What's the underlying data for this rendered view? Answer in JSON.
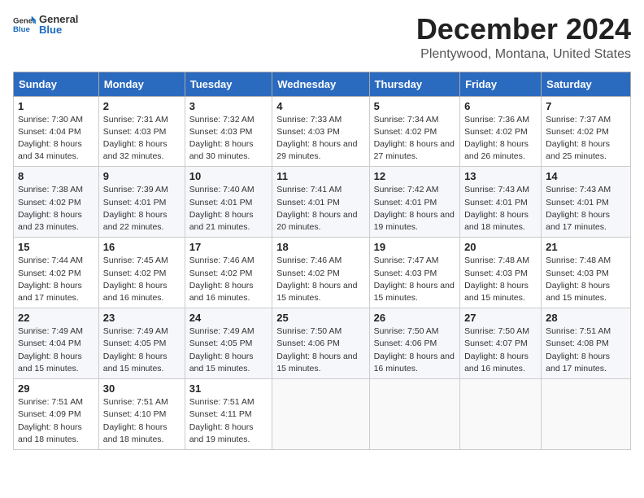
{
  "header": {
    "logo_general": "General",
    "logo_blue": "Blue",
    "month_title": "December 2024",
    "location": "Plentywood, Montana, United States"
  },
  "days_of_week": [
    "Sunday",
    "Monday",
    "Tuesday",
    "Wednesday",
    "Thursday",
    "Friday",
    "Saturday"
  ],
  "weeks": [
    [
      {
        "day": "1",
        "sunrise": "7:30 AM",
        "sunset": "4:04 PM",
        "daylight": "8 hours and 34 minutes."
      },
      {
        "day": "2",
        "sunrise": "7:31 AM",
        "sunset": "4:03 PM",
        "daylight": "8 hours and 32 minutes."
      },
      {
        "day": "3",
        "sunrise": "7:32 AM",
        "sunset": "4:03 PM",
        "daylight": "8 hours and 30 minutes."
      },
      {
        "day": "4",
        "sunrise": "7:33 AM",
        "sunset": "4:03 PM",
        "daylight": "8 hours and 29 minutes."
      },
      {
        "day": "5",
        "sunrise": "7:34 AM",
        "sunset": "4:02 PM",
        "daylight": "8 hours and 27 minutes."
      },
      {
        "day": "6",
        "sunrise": "7:36 AM",
        "sunset": "4:02 PM",
        "daylight": "8 hours and 26 minutes."
      },
      {
        "day": "7",
        "sunrise": "7:37 AM",
        "sunset": "4:02 PM",
        "daylight": "8 hours and 25 minutes."
      }
    ],
    [
      {
        "day": "8",
        "sunrise": "7:38 AM",
        "sunset": "4:02 PM",
        "daylight": "8 hours and 23 minutes."
      },
      {
        "day": "9",
        "sunrise": "7:39 AM",
        "sunset": "4:01 PM",
        "daylight": "8 hours and 22 minutes."
      },
      {
        "day": "10",
        "sunrise": "7:40 AM",
        "sunset": "4:01 PM",
        "daylight": "8 hours and 21 minutes."
      },
      {
        "day": "11",
        "sunrise": "7:41 AM",
        "sunset": "4:01 PM",
        "daylight": "8 hours and 20 minutes."
      },
      {
        "day": "12",
        "sunrise": "7:42 AM",
        "sunset": "4:01 PM",
        "daylight": "8 hours and 19 minutes."
      },
      {
        "day": "13",
        "sunrise": "7:43 AM",
        "sunset": "4:01 PM",
        "daylight": "8 hours and 18 minutes."
      },
      {
        "day": "14",
        "sunrise": "7:43 AM",
        "sunset": "4:01 PM",
        "daylight": "8 hours and 17 minutes."
      }
    ],
    [
      {
        "day": "15",
        "sunrise": "7:44 AM",
        "sunset": "4:02 PM",
        "daylight": "8 hours and 17 minutes."
      },
      {
        "day": "16",
        "sunrise": "7:45 AM",
        "sunset": "4:02 PM",
        "daylight": "8 hours and 16 minutes."
      },
      {
        "day": "17",
        "sunrise": "7:46 AM",
        "sunset": "4:02 PM",
        "daylight": "8 hours and 16 minutes."
      },
      {
        "day": "18",
        "sunrise": "7:46 AM",
        "sunset": "4:02 PM",
        "daylight": "8 hours and 15 minutes."
      },
      {
        "day": "19",
        "sunrise": "7:47 AM",
        "sunset": "4:03 PM",
        "daylight": "8 hours and 15 minutes."
      },
      {
        "day": "20",
        "sunrise": "7:48 AM",
        "sunset": "4:03 PM",
        "daylight": "8 hours and 15 minutes."
      },
      {
        "day": "21",
        "sunrise": "7:48 AM",
        "sunset": "4:03 PM",
        "daylight": "8 hours and 15 minutes."
      }
    ],
    [
      {
        "day": "22",
        "sunrise": "7:49 AM",
        "sunset": "4:04 PM",
        "daylight": "8 hours and 15 minutes."
      },
      {
        "day": "23",
        "sunrise": "7:49 AM",
        "sunset": "4:05 PM",
        "daylight": "8 hours and 15 minutes."
      },
      {
        "day": "24",
        "sunrise": "7:49 AM",
        "sunset": "4:05 PM",
        "daylight": "8 hours and 15 minutes."
      },
      {
        "day": "25",
        "sunrise": "7:50 AM",
        "sunset": "4:06 PM",
        "daylight": "8 hours and 15 minutes."
      },
      {
        "day": "26",
        "sunrise": "7:50 AM",
        "sunset": "4:06 PM",
        "daylight": "8 hours and 16 minutes."
      },
      {
        "day": "27",
        "sunrise": "7:50 AM",
        "sunset": "4:07 PM",
        "daylight": "8 hours and 16 minutes."
      },
      {
        "day": "28",
        "sunrise": "7:51 AM",
        "sunset": "4:08 PM",
        "daylight": "8 hours and 17 minutes."
      }
    ],
    [
      {
        "day": "29",
        "sunrise": "7:51 AM",
        "sunset": "4:09 PM",
        "daylight": "8 hours and 18 minutes."
      },
      {
        "day": "30",
        "sunrise": "7:51 AM",
        "sunset": "4:10 PM",
        "daylight": "8 hours and 18 minutes."
      },
      {
        "day": "31",
        "sunrise": "7:51 AM",
        "sunset": "4:11 PM",
        "daylight": "8 hours and 19 minutes."
      },
      null,
      null,
      null,
      null
    ]
  ],
  "labels": {
    "sunrise": "Sunrise:",
    "sunset": "Sunset:",
    "daylight": "Daylight:"
  }
}
